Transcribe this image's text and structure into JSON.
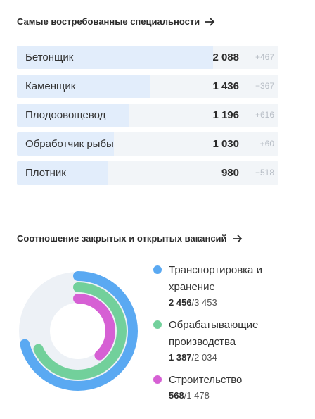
{
  "specialties": {
    "title": "Самые востребованные специальности",
    "items": [
      {
        "label": "Бетонщик",
        "value": "2 088",
        "delta": "+467",
        "share": 0.75
      },
      {
        "label": "Каменщик",
        "value": "1 436",
        "delta": "−367",
        "share": 0.51
      },
      {
        "label": "Плодоовощевод",
        "value": "1 196",
        "delta": "+616",
        "share": 0.43
      },
      {
        "label": "Обработчик рыбы",
        "value": "1 030",
        "delta": "+60",
        "share": 0.37
      },
      {
        "label": "Плотник",
        "value": "980",
        "delta": "−518",
        "share": 0.35
      }
    ]
  },
  "vacancies": {
    "title": "Соотношение закрытых и открытых вакансий",
    "items": [
      {
        "name_line1": "Транспортировка и",
        "name_line2": "хранение",
        "closed": "2 456",
        "sep": "/",
        "total": "3 453",
        "closed_num": 2456,
        "total_num": 3453,
        "color": "#5aa9f2"
      },
      {
        "name_line1": "Обрабатывающие",
        "name_line2": "производства",
        "closed": "1 387",
        "sep": "/",
        "total": "2 034",
        "closed_num": 1387,
        "total_num": 2034,
        "color": "#72d09b"
      },
      {
        "name_line1": "Строительство",
        "name_line2": "",
        "closed": "568",
        "sep": "/",
        "total": "1 478",
        "closed_num": 568,
        "total_num": 1478,
        "color": "#d660d4"
      }
    ]
  },
  "colors": {
    "bar_fill": "#e2edfb",
    "bar_track": "#f2f5f8",
    "donut_track": "#edf1f6"
  },
  "icons": {
    "title_arrow": "arrow-right-icon"
  }
}
